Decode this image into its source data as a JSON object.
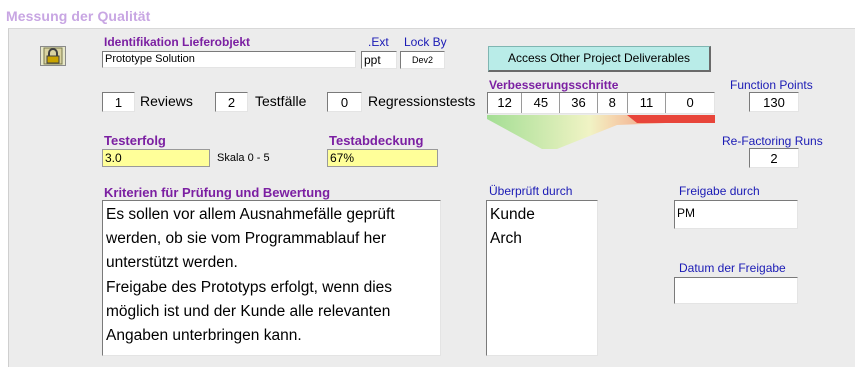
{
  "header": {
    "title": "Messung der Qualität"
  },
  "deliverable": {
    "id_label": "Identifikation Lieferobjekt",
    "id_value": "Prototype Solution",
    "ext_label": ".Ext",
    "ext_value": "ppt",
    "lock_label": "Lock By",
    "lock_value": "Dev2",
    "lock_icon": "padlock-icon"
  },
  "access_button": {
    "label": "Access Other Project Deliverables"
  },
  "counts": {
    "reviews_value": "1",
    "reviews_label": "Reviews",
    "tests_value": "2",
    "tests_label": "Testfälle",
    "regression_value": "0",
    "regression_label": "Regressionstests"
  },
  "improvement": {
    "label": "Verbesserungsschritte",
    "steps": [
      "12",
      "45",
      "36",
      "8",
      "11",
      "0"
    ]
  },
  "function_points": {
    "label": "Function Points",
    "value": "130"
  },
  "refactoring": {
    "label": "Re-Factoring Runs",
    "value": "2"
  },
  "test_success": {
    "label": "Testerfolg",
    "value": "3.0",
    "scale": "Skala 0 - 5"
  },
  "test_coverage": {
    "label": "Testabdeckung",
    "value": "67%"
  },
  "criteria": {
    "label": "Kriterien für Prüfung und Bewertung",
    "lines": [
      "Es sollen vor allem Ausnahmefälle geprüft",
      "werden, ob sie vom Programmablauf her",
      "unterstützt werden.",
      "Freigabe des Prototyps erfolgt, wenn dies",
      "möglich ist und der Kunde alle relevanten",
      "Angaben unterbringen kann."
    ]
  },
  "reviewed_by": {
    "label": "Überprüft durch",
    "items": [
      "Kunde",
      "Arch"
    ]
  },
  "approval": {
    "label": "Freigabe durch",
    "value": "PM"
  },
  "approval_date": {
    "label": "Datum der Freigabe",
    "value": ""
  }
}
